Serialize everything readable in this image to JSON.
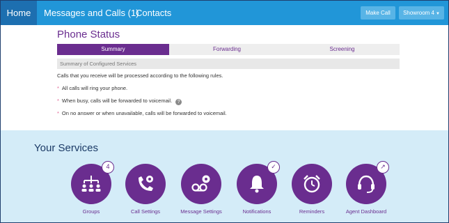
{
  "nav": {
    "home": "Home",
    "messages_calls": "Messages and Calls (1)",
    "contacts": "Contacts",
    "make_call": "Make Call",
    "showroom": "Showroom 4"
  },
  "phone_status": {
    "title": "Phone Status",
    "tabs": [
      "Summary",
      "Forwarding",
      "Screening"
    ],
    "active_tab": "Summary",
    "section_header": "Summary of Configured Services",
    "intro": "Calls that you receive will be processed according to the following rules.",
    "rules": [
      "All calls will ring your phone.",
      "When busy, calls will be forwarded to voicemail.",
      "On no answer or when unavailable, calls will be forwarded to voicemail."
    ],
    "help_glyph": "?"
  },
  "services": {
    "title": "Your Services",
    "items": [
      {
        "label": "Groups",
        "icon": "groups-icon",
        "badge": "4"
      },
      {
        "label": "Call Settings",
        "icon": "phone-gear-icon"
      },
      {
        "label": "Message Settings",
        "icon": "voicemail-gear-icon"
      },
      {
        "label": "Notifications",
        "icon": "bell-icon",
        "badge": "✓"
      },
      {
        "label": "Reminders",
        "icon": "alarm-clock-icon"
      },
      {
        "label": "Agent Dashboard",
        "icon": "headset-icon",
        "badge": "↗"
      }
    ]
  },
  "colors": {
    "nav_bg": "#2196d8",
    "nav_active": "#1d6fb0",
    "purple": "#6a2d8f",
    "services_bg": "#d4ecf8"
  }
}
